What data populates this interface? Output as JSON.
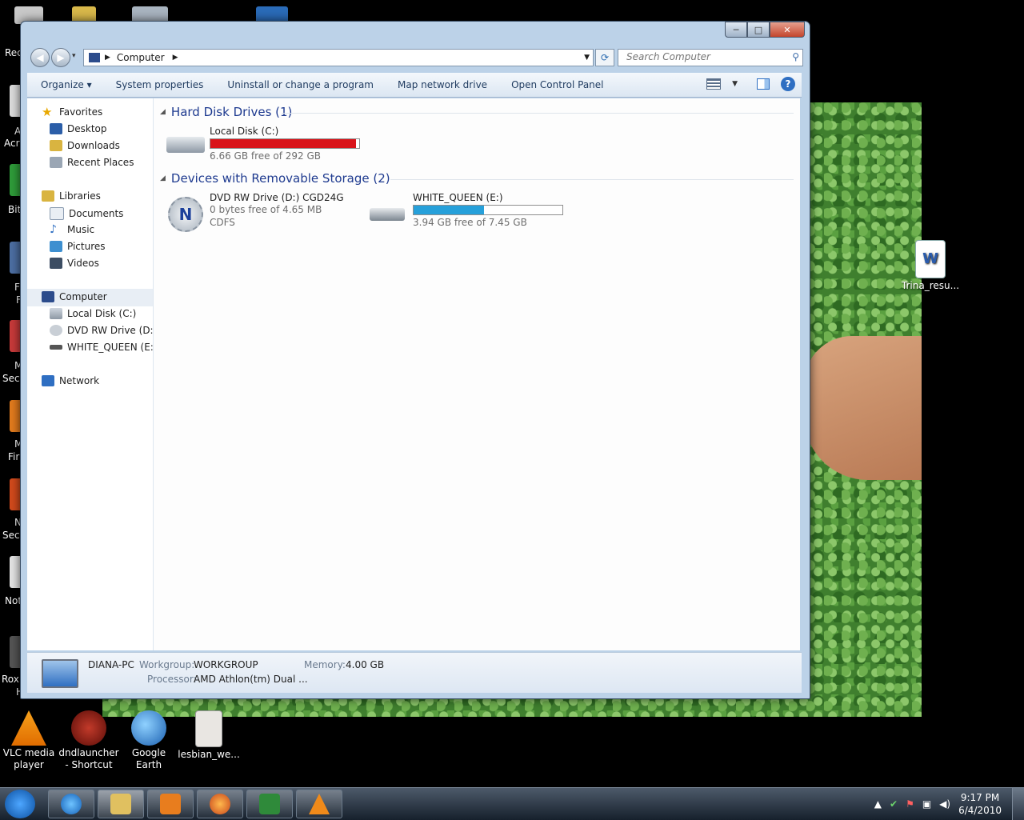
{
  "desktop": {
    "left_labels": [
      "Rec",
      "A",
      "Acr",
      "Bit",
      "F",
      "F",
      "M",
      "Secu",
      "M",
      "Fir",
      "N",
      "Secu",
      "Not",
      "Roxi",
      "H"
    ],
    "bottom_icons": [
      {
        "label_line1": "VLC media",
        "label_line2": "player",
        "icon": "vlc-icon"
      },
      {
        "label_line1": "dndlauncher",
        "label_line2": "- Shortcut",
        "icon": "dndlauncher-icon"
      },
      {
        "label_line1": "Google Earth",
        "label_line2": "",
        "icon": "google-earth-icon"
      },
      {
        "label_line1": "lesbian_we...",
        "label_line2": "",
        "icon": "image-icon"
      }
    ],
    "right_icon": {
      "label": "Trina_resu...",
      "icon": "word-document-icon"
    }
  },
  "window": {
    "caption": {
      "minimize": "─",
      "maximize": "□",
      "close": "✕"
    },
    "address": {
      "crumb": "Computer",
      "search_placeholder": "Search Computer"
    },
    "toolbar": {
      "organize": "Organize",
      "system_properties": "System properties",
      "uninstall": "Uninstall or change a program",
      "map_drive": "Map network drive",
      "control_panel": "Open Control Panel",
      "help": "?"
    },
    "nav": {
      "favorites": "Favorites",
      "desktop": "Desktop",
      "downloads": "Downloads",
      "recent": "Recent Places",
      "libraries": "Libraries",
      "documents": "Documents",
      "music": "Music",
      "pictures": "Pictures",
      "videos": "Videos",
      "computer": "Computer",
      "local_disk": "Local Disk (C:)",
      "dvd": "DVD RW Drive (D:) C",
      "white_queen": "WHITE_QUEEN (E:)",
      "network": "Network"
    },
    "groups": {
      "hdd": {
        "title": "Hard Disk Drives (1)",
        "drives": [
          {
            "name": "Local Disk (C:)",
            "free": "6.66 GB free of 292 GB",
            "used_fraction": 0.977,
            "bar_color": "#d9141a"
          }
        ]
      },
      "removable": {
        "title": "Devices with Removable Storage (2)",
        "dvd": {
          "name": "DVD RW Drive (D:) CGD24G",
          "free": "0 bytes free of 4.65 MB",
          "fs": "CDFS"
        },
        "usb": {
          "name": "WHITE_QUEEN (E:)",
          "free": "3.94 GB free of 7.45 GB",
          "used_fraction": 0.471,
          "bar_color": "#26a0da"
        }
      }
    },
    "details": {
      "pc_name": "DIANA-PC",
      "workgroup_label": "Workgroup:",
      "workgroup": "WORKGROUP",
      "memory_label": "Memory:",
      "memory": "4.00 GB",
      "processor_label": "Processor:",
      "processor": "AMD Athlon(tm) Dual ..."
    }
  },
  "taskbar": {
    "apps": [
      "internet-explorer-icon",
      "windows-explorer-icon",
      "media-player-icon",
      "firefox-icon",
      "excel-icon",
      "vlc-icon"
    ],
    "time": "9:17 PM",
    "date": "6/4/2010"
  }
}
